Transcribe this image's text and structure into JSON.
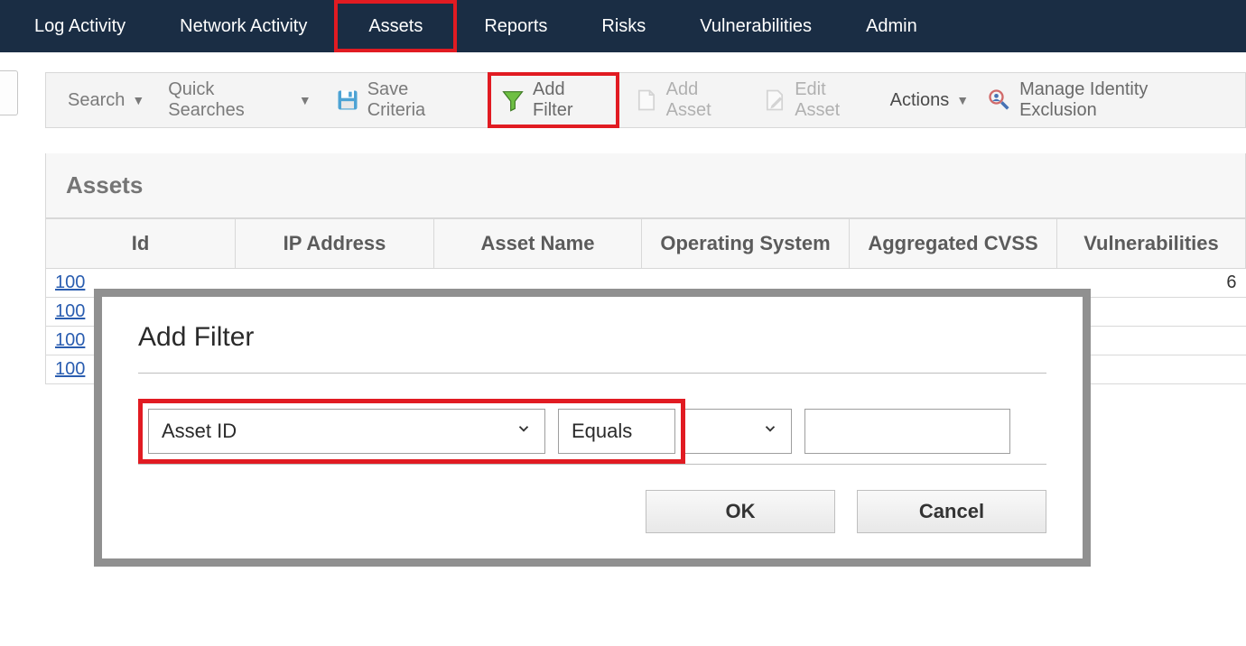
{
  "nav": {
    "log_activity": "Log Activity",
    "network_activity": "Network Activity",
    "assets": "Assets",
    "reports": "Reports",
    "risks": "Risks",
    "vulnerabilities": "Vulnerabilities",
    "admin": "Admin"
  },
  "toolbar": {
    "search": "Search",
    "quick_searches": "Quick Searches",
    "save_criteria": "Save Criteria",
    "add_filter": "Add Filter",
    "add_asset": "Add Asset",
    "edit_asset": "Edit Asset",
    "actions": "Actions",
    "manage_identity_exclusion": "Manage Identity Exclusion"
  },
  "panel": {
    "title": "Assets",
    "columns": {
      "id": "Id",
      "ip": "IP Address",
      "asset_name": "Asset Name",
      "os": "Operating System",
      "cvss": "Aggregated CVSS",
      "vulns": "Vulnerabilities"
    },
    "rows": [
      {
        "id": "100"
      },
      {
        "id": "100"
      },
      {
        "id": "100"
      },
      {
        "id": "100"
      }
    ],
    "truncated_right_value": "6"
  },
  "dialog": {
    "title": "Add Filter",
    "field_select": "Asset ID",
    "operator_select": "Equals",
    "value_input": "",
    "ok_label": "OK",
    "cancel_label": "Cancel"
  }
}
